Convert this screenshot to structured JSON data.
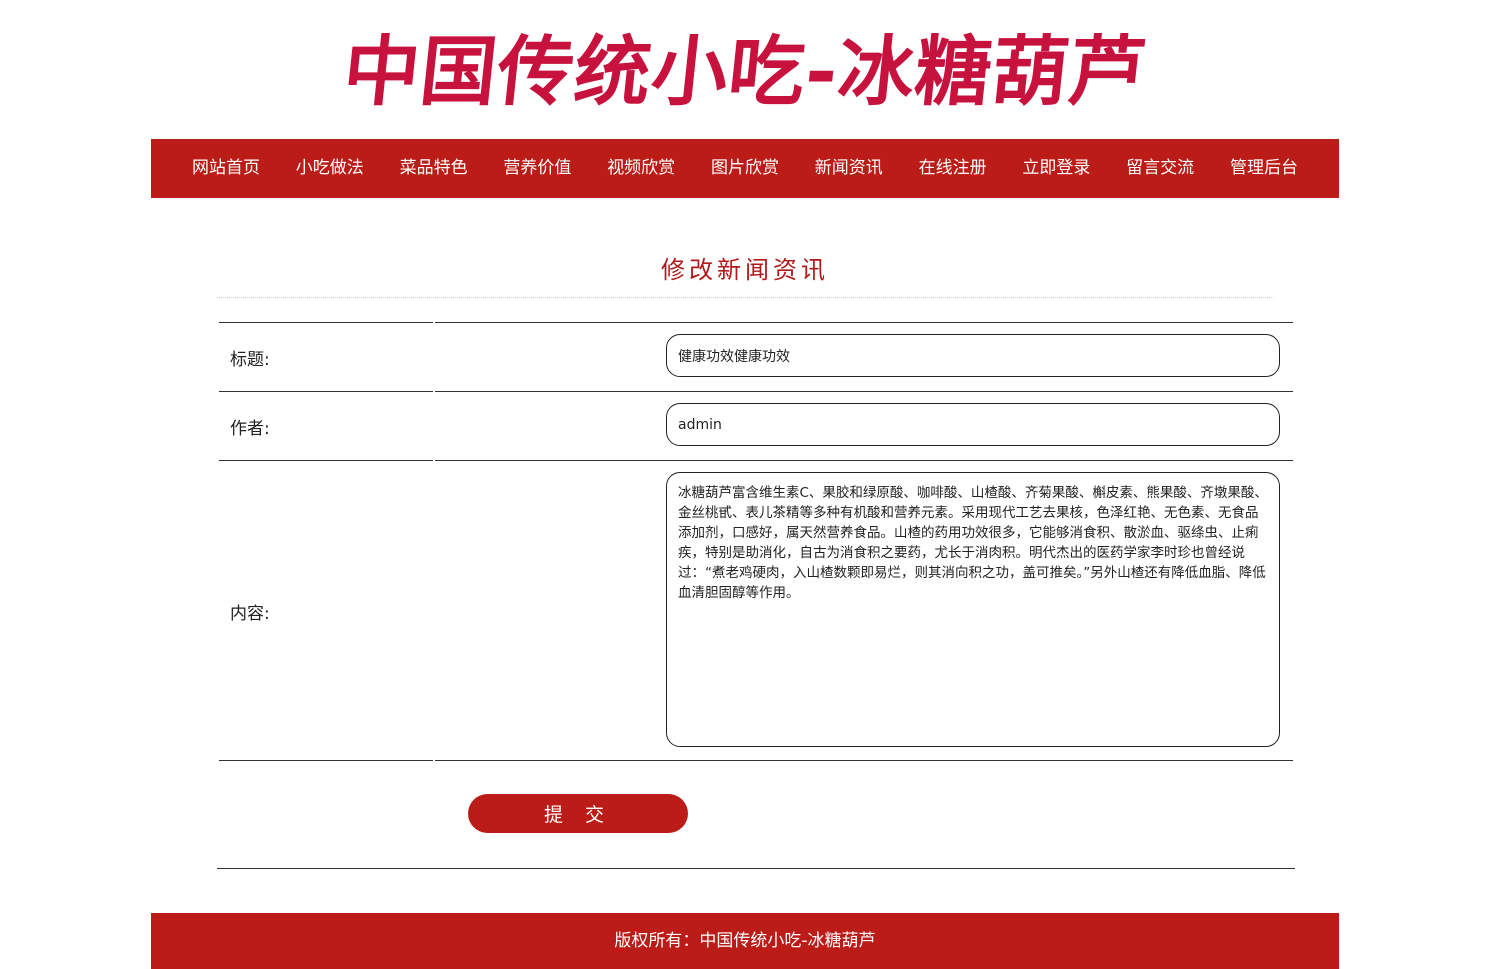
{
  "site": {
    "title": "中国传统小吃-冰糖葫芦"
  },
  "nav": {
    "items": [
      {
        "label": "网站首页"
      },
      {
        "label": "小吃做法"
      },
      {
        "label": "菜品特色"
      },
      {
        "label": "营养价值"
      },
      {
        "label": "视频欣赏"
      },
      {
        "label": "图片欣赏"
      },
      {
        "label": "新闻资讯"
      },
      {
        "label": "在线注册"
      },
      {
        "label": "立即登录"
      },
      {
        "label": "留言交流"
      },
      {
        "label": "管理后台"
      }
    ]
  },
  "form": {
    "title": "修改新闻资讯",
    "fields": {
      "title_label": "标题:",
      "title_value": "健康功效健康功效",
      "author_label": "作者:",
      "author_value": "admin",
      "content_label": "内容:",
      "content_value": "冰糖葫芦富含维生素C、果胶和绿原酸、咖啡酸、山楂酸、齐菊果酸、槲皮素、熊果酸、齐墩果酸、金丝桃甙、表儿茶精等多种有机酸和营养元素。采用现代工艺去果核，色泽红艳、无色素、无食品添加剂，口感好，属天然营养食品。山楂的药用功效很多，它能够消食积、散淤血、驱绦虫、止痢疾，特别是助消化，自古为消食积之要药，尤长于消肉积。明代杰出的医药学家李时珍也曾经说过：“煮老鸡硬肉，入山楂数颗即易烂，则其消向积之功，盖可推矣。”另外山楂还有降低血脂、降低血清胆固醇等作用。"
    },
    "submit_label": "提 交"
  },
  "footer": {
    "text": "版权所有：中国传统小吃-冰糖葫芦"
  },
  "colors": {
    "brand_red": "#bc1c17",
    "title_red": "#c8123e"
  }
}
